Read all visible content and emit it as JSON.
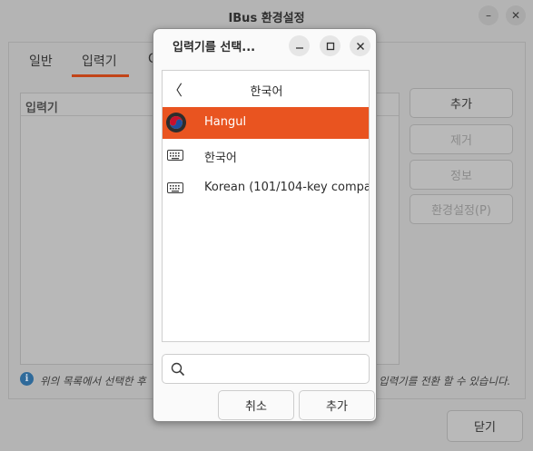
{
  "main_window": {
    "title": "IBus 환경설정",
    "tabs": [
      {
        "label": "일반",
        "active": false
      },
      {
        "label": "입력기",
        "active": true
      },
      {
        "label": "O",
        "active": false
      }
    ],
    "list_header": "입력기",
    "side_buttons": {
      "add": "추가",
      "remove": "제거",
      "about": "정보",
      "preferences": "환경설정(P)"
    },
    "info_text_left": "위의 목록에서 선택한 후 ",
    "info_text_right": "입력기를 전환 할 수 있습니다.",
    "close_button": "닫기"
  },
  "dialog": {
    "title": "입력기를 선택...",
    "language_header": "한국어",
    "engines": [
      {
        "label": "Hangul",
        "icon": "hangul-taegeuk-icon",
        "selected": true
      },
      {
        "label": "한국어",
        "icon": "keyboard-icon",
        "selected": false
      },
      {
        "label": "Korean (101/104-key compa",
        "icon": "keyboard-icon",
        "selected": false
      }
    ],
    "search_value": "",
    "cancel_button": "취소",
    "add_button": "추가"
  },
  "colors": {
    "accent": "#e95420",
    "tab_underline": "#c24418",
    "info_icon": "#2f6a9a"
  }
}
